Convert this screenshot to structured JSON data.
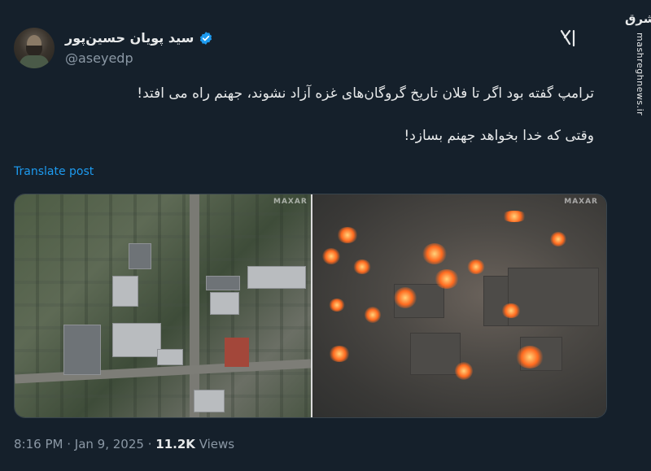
{
  "tweet": {
    "display_name": "سید پویان حسین‌پور",
    "handle": "@aseyedp",
    "verified_color": "#1d9bf0",
    "text_line1": "ترامپ گفته بود اگر تا فلان تاریخ گروگان‌های غزه آزاد نشوند، جهنم راه می افتد!",
    "text_line2": "وقتی که خدا بخواهد جهنم بسازد!",
    "translate_label": "Translate post",
    "time": "8:16 PM",
    "date": "Jan 9, 2025",
    "views_count": "11.2K",
    "views_label": "Views"
  },
  "media": {
    "left_watermark": "MAXAR",
    "right_watermark": "MAXAR"
  },
  "icons": {
    "verified": "verified-badge-icon",
    "grok": "grok-icon"
  },
  "site": {
    "logo": "مشرق",
    "url": "mashreghnews.ir"
  },
  "colors": {
    "background": "#15202b",
    "link": "#1d9bf0",
    "secondary_text": "#8b98a5"
  }
}
